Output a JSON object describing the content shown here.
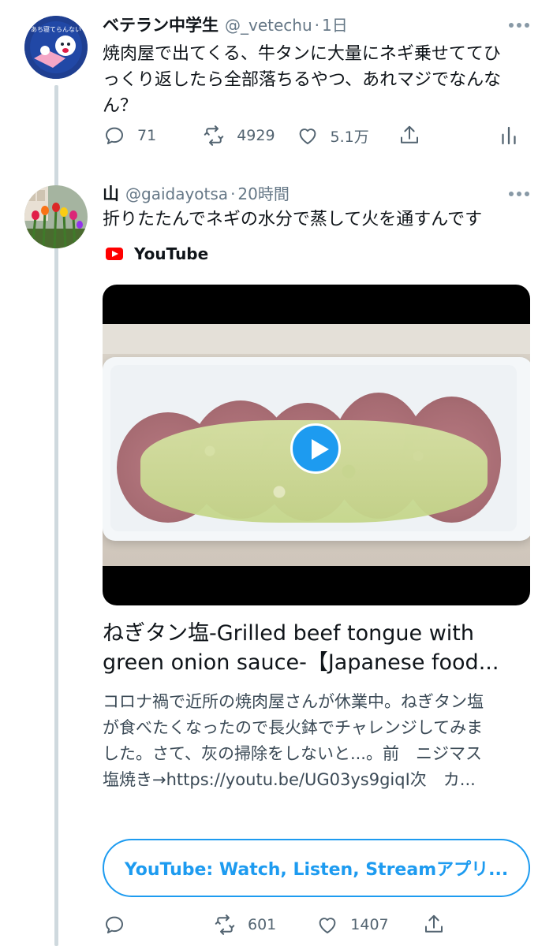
{
  "tweet1": {
    "name": "ベテラン中学生",
    "handle": "@_vetechu",
    "time": "1日",
    "avatar_text": "あち寝てらんない",
    "lines": [
      "焼肉屋で出てくる、牛タンに大量にネギ乗せててひ",
      "っくり返したら全部落ちるやつ、あれマジでなんな",
      "ん？"
    ],
    "reply_count": "71",
    "retweet_count": "4929",
    "like_count": "5.1万",
    "icons": {
      "reply": "reply-icon",
      "retweet": "retweet-icon",
      "like": "like-icon",
      "share": "share-icon",
      "analytics": "analytics-icon"
    }
  },
  "tweet2": {
    "name": "山",
    "handle": "@gaidayotsa",
    "time": "20時間",
    "text": "折りたたんでネギの水分で蒸して火を通すんです",
    "source_label": "YouTube",
    "card": {
      "title_lines": [
        "ねぎタン塩-Grilled beef tongue with",
        "green onion sauce-【Japanese food..."
      ],
      "desc_lines": [
        "コロナ禍で近所の焼肉屋さんが休業中。ねぎタン塩",
        "が食べたくなったので長火鉢でチャレンジしてみま",
        "した。さて、灰の掃除をしないと...。前　ニジマス",
        "塩焼き→https://youtu.be/UG03ys9giqI次　カ..."
      ],
      "app_button": "YouTube: Watch, Listen, Streamアプリ..."
    },
    "retweet_count": "601",
    "like_count": "1407"
  },
  "colors": {
    "accent": "#1d9bf0",
    "muted": "#657786",
    "youtube_red": "#ff0000",
    "thread_line": "#cfd9de"
  }
}
